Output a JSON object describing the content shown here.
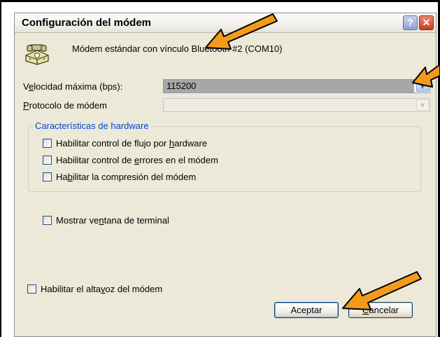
{
  "dialog": {
    "title": "Configuración del módem",
    "help_label": "?",
    "close_label": "✕"
  },
  "modem": {
    "name": "Módem estándar con vínculo Bluetooth #2 (COM10)"
  },
  "speed": {
    "label_pre": "V",
    "label_u": "e",
    "label_post": "locidad máxima (bps):",
    "value": "115200"
  },
  "protocol": {
    "label_u": "P",
    "label_post": "rotocolo de módem",
    "value": ""
  },
  "hardware": {
    "legend": "Características de hardware",
    "flow_pre": "Habilitar control de flujo por ",
    "flow_u": "h",
    "flow_post": "ardware",
    "error_pre": "Habilitar control de ",
    "error_u": "e",
    "error_post": "rrores en el módem",
    "comp_pre": "Ha",
    "comp_u": "b",
    "comp_post": "ilitar la compresión del módem"
  },
  "terminal": {
    "pre": "Mostrar ve",
    "u": "n",
    "post": "tana de terminal"
  },
  "speaker": {
    "pre": "Habilitar el alta",
    "u": "v",
    "post": "oz del módem"
  },
  "buttons": {
    "ok": "Aceptar",
    "cancel_u": "C",
    "cancel_post": "ancelar"
  },
  "colors": {
    "annotation_arrow": "#f39a1c",
    "group_legend": "#0046d5",
    "dialog_bg": "#ece9d8"
  }
}
